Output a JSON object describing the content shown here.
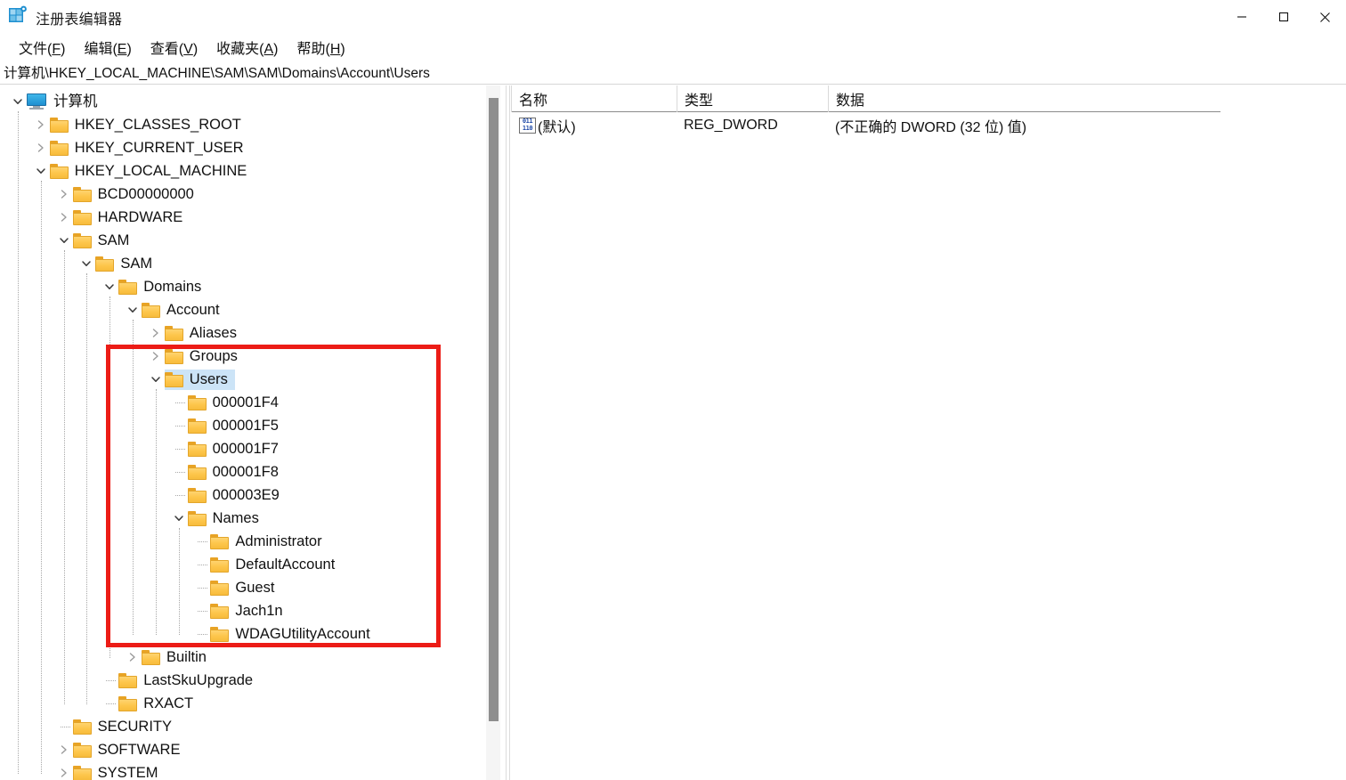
{
  "window": {
    "title": "注册表编辑器",
    "app_icon": "registry-editor-icon",
    "controls": {
      "minimize": "最小化",
      "maximize": "最大化",
      "close": "关闭"
    }
  },
  "menubar": {
    "items": [
      {
        "label": "文件(F)",
        "text": "文件(",
        "accel": "F",
        "tail": ")"
      },
      {
        "label": "编辑(E)",
        "text": "编辑(",
        "accel": "E",
        "tail": ")"
      },
      {
        "label": "查看(V)",
        "text": "查看(",
        "accel": "V",
        "tail": ")"
      },
      {
        "label": "收藏夹(A)",
        "text": "收藏夹(",
        "accel": "A",
        "tail": ")"
      },
      {
        "label": "帮助(H)",
        "text": "帮助(",
        "accel": "H",
        "tail": ")"
      }
    ]
  },
  "address": {
    "path": "计算机\\HKEY_LOCAL_MACHINE\\SAM\\SAM\\Domains\\Account\\Users"
  },
  "tree": {
    "nodes": [
      {
        "label": "计算机",
        "depth": 0,
        "icon": "monitor",
        "state": "expanded",
        "selected": false
      },
      {
        "label": "HKEY_CLASSES_ROOT",
        "depth": 1,
        "icon": "folder",
        "state": "collapsed",
        "selected": false
      },
      {
        "label": "HKEY_CURRENT_USER",
        "depth": 1,
        "icon": "folder",
        "state": "collapsed",
        "selected": false
      },
      {
        "label": "HKEY_LOCAL_MACHINE",
        "depth": 1,
        "icon": "folder",
        "state": "expanded",
        "selected": false
      },
      {
        "label": "BCD00000000",
        "depth": 2,
        "icon": "folder",
        "state": "collapsed",
        "selected": false
      },
      {
        "label": "HARDWARE",
        "depth": 2,
        "icon": "folder",
        "state": "collapsed",
        "selected": false
      },
      {
        "label": "SAM",
        "depth": 2,
        "icon": "folder",
        "state": "expanded",
        "selected": false
      },
      {
        "label": "SAM",
        "depth": 3,
        "icon": "folder",
        "state": "expanded",
        "selected": false
      },
      {
        "label": "Domains",
        "depth": 4,
        "icon": "folder",
        "state": "expanded",
        "selected": false
      },
      {
        "label": "Account",
        "depth": 5,
        "icon": "folder",
        "state": "expanded",
        "selected": false
      },
      {
        "label": "Aliases",
        "depth": 6,
        "icon": "folder",
        "state": "collapsed",
        "selected": false
      },
      {
        "label": "Groups",
        "depth": 6,
        "icon": "folder",
        "state": "collapsed",
        "selected": false
      },
      {
        "label": "Users",
        "depth": 6,
        "icon": "folder",
        "state": "expanded",
        "selected": true
      },
      {
        "label": "000001F4",
        "depth": 7,
        "icon": "folder",
        "state": "leaf",
        "selected": false
      },
      {
        "label": "000001F5",
        "depth": 7,
        "icon": "folder",
        "state": "leaf",
        "selected": false
      },
      {
        "label": "000001F7",
        "depth": 7,
        "icon": "folder",
        "state": "leaf",
        "selected": false
      },
      {
        "label": "000001F8",
        "depth": 7,
        "icon": "folder",
        "state": "leaf",
        "selected": false
      },
      {
        "label": "000003E9",
        "depth": 7,
        "icon": "folder",
        "state": "leaf",
        "selected": false
      },
      {
        "label": "Names",
        "depth": 7,
        "icon": "folder",
        "state": "expanded",
        "selected": false
      },
      {
        "label": "Administrator",
        "depth": 8,
        "icon": "folder",
        "state": "leaf",
        "selected": false
      },
      {
        "label": "DefaultAccount",
        "depth": 8,
        "icon": "folder",
        "state": "leaf",
        "selected": false
      },
      {
        "label": "Guest",
        "depth": 8,
        "icon": "folder",
        "state": "leaf",
        "selected": false
      },
      {
        "label": "Jach1n",
        "depth": 8,
        "icon": "folder",
        "state": "leaf",
        "selected": false
      },
      {
        "label": "WDAGUtilityAccount",
        "depth": 8,
        "icon": "folder",
        "state": "leaf",
        "selected": false
      },
      {
        "label": "Builtin",
        "depth": 5,
        "icon": "folder",
        "state": "collapsed",
        "selected": false
      },
      {
        "label": "LastSkuUpgrade",
        "depth": 4,
        "icon": "folder",
        "state": "leaf",
        "selected": false
      },
      {
        "label": "RXACT",
        "depth": 4,
        "icon": "folder",
        "state": "leaf",
        "selected": false
      },
      {
        "label": "SECURITY",
        "depth": 2,
        "icon": "folder",
        "state": "leaf",
        "selected": false
      },
      {
        "label": "SOFTWARE",
        "depth": 2,
        "icon": "folder",
        "state": "collapsed",
        "selected": false
      },
      {
        "label": "SYSTEM",
        "depth": 2,
        "icon": "folder",
        "state": "collapsed",
        "selected": false
      }
    ]
  },
  "values": {
    "columns": [
      "名称",
      "类型",
      "数据"
    ],
    "rows": [
      {
        "name": "(默认)",
        "type": "REG_DWORD",
        "data": "(不正确的 DWORD (32 位) 值)",
        "icon": "dword-value-icon"
      }
    ]
  },
  "annotation": {
    "color": "#ec1c16",
    "shape": "rectangle",
    "highlights_label": "Users"
  },
  "colors": {
    "selection": "#cce4f7",
    "folder": "#fdc54a",
    "annotation_red": "#ec1c16",
    "accent_blue": "#1e8fd0"
  }
}
